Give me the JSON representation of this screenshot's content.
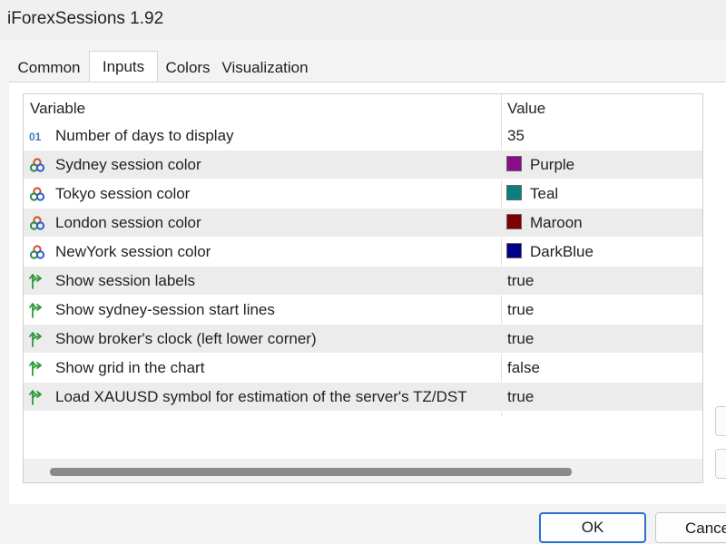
{
  "window": {
    "title": "iForexSessions 1.92"
  },
  "tabs": [
    {
      "label": "Common",
      "active": false
    },
    {
      "label": "Inputs",
      "active": true
    },
    {
      "label": "Colors",
      "active": false
    },
    {
      "label": "Visualization",
      "active": false
    }
  ],
  "grid": {
    "headers": {
      "variable": "Variable",
      "value": "Value"
    },
    "rows": [
      {
        "icon": "integer-icon",
        "name": "Number of days to display",
        "value": "35"
      },
      {
        "icon": "color-palette-icon",
        "name": "Sydney session color",
        "value": "Purple",
        "color": "#8b0d8b"
      },
      {
        "icon": "color-palette-icon",
        "name": "Tokyo session color",
        "value": "Teal",
        "color": "#0e7f7f"
      },
      {
        "icon": "color-palette-icon",
        "name": "London session color",
        "value": "Maroon",
        "color": "#7f0000"
      },
      {
        "icon": "color-palette-icon",
        "name": "NewYork session color",
        "value": "DarkBlue",
        "color": "#00008b"
      },
      {
        "icon": "boolean-arrow-icon",
        "name": "Show session labels",
        "value": "true"
      },
      {
        "icon": "boolean-arrow-icon",
        "name": "Show sydney-session start lines",
        "value": "true"
      },
      {
        "icon": "boolean-arrow-icon",
        "name": "Show broker's clock (left lower corner)",
        "value": "true"
      },
      {
        "icon": "boolean-arrow-icon",
        "name": "Show grid in the chart",
        "value": "false"
      },
      {
        "icon": "boolean-arrow-icon",
        "name": "Load XAUUSD symbol for estimation of the server's TZ/DST",
        "value": "true"
      }
    ]
  },
  "buttons": {
    "ok": "OK",
    "cancel": "Cancel"
  },
  "theme": {
    "accent": "#2b6fd1",
    "int_icon": "#3a7bbf",
    "bool_icon": "#2e9a3a"
  }
}
